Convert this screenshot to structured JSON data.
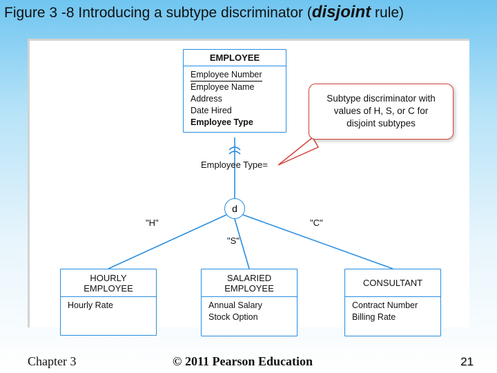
{
  "title": {
    "prefix": "Figure 3 -8 Introducing a subtype discriminator (",
    "emph": "disjoint",
    "suffix": " rule)"
  },
  "supertype": {
    "name": "EMPLOYEE",
    "key": "Employee Number",
    "attrs": [
      "Employee Name",
      "Address",
      "Date Hired",
      "Employee Type"
    ]
  },
  "predicate": "Employee Type=",
  "disjoint_symbol": "d",
  "discriminator_values": {
    "H": "\"H\"",
    "S": "\"S\"",
    "C": "\"C\""
  },
  "subtypes": [
    {
      "name": "HOURLY EMPLOYEE",
      "attrs": [
        "Hourly Rate"
      ]
    },
    {
      "name": "SALARIED EMPLOYEE",
      "attrs": [
        "Annual Salary",
        "Stock Option"
      ]
    },
    {
      "name": "CONSULTANT",
      "attrs": [
        "Contract Number",
        "Billing Rate"
      ]
    }
  ],
  "callout": "Subtype discriminator with values of H, S, or C for disjoint subtypes",
  "footer": {
    "chapter": "Chapter 3",
    "copyright": "© 2011 Pearson Education",
    "page": "21"
  }
}
